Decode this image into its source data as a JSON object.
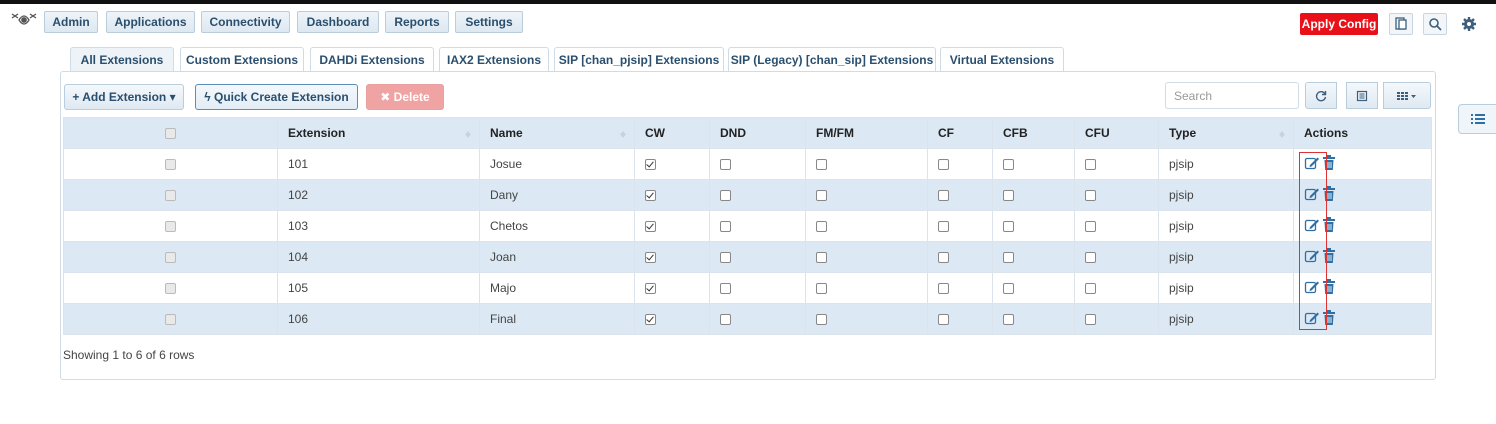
{
  "nav": {
    "items": [
      "Admin",
      "Applications",
      "Connectivity",
      "Dashboard",
      "Reports",
      "Settings"
    ],
    "apply_config": "Apply Config"
  },
  "tabs": [
    "All Extensions",
    "Custom Extensions",
    "DAHDi Extensions",
    "IAX2 Extensions",
    "SIP [chan_pjsip] Extensions",
    "SIP (Legacy) [chan_sip] Extensions",
    "Virtual Extensions"
  ],
  "toolbar": {
    "add_label": "+ Add Extension ▾",
    "quick_label": "ϟ Quick Create Extension",
    "delete_label": "✖ Delete",
    "search_placeholder": "Search"
  },
  "table": {
    "columns": [
      "",
      "Extension",
      "Name",
      "CW",
      "DND",
      "FM/FM",
      "CF",
      "CFB",
      "CFU",
      "Type",
      "Actions"
    ],
    "rows": [
      {
        "extension": "101",
        "name": "Josue",
        "cw": true,
        "type": "pjsip"
      },
      {
        "extension": "102",
        "name": "Dany",
        "cw": true,
        "type": "pjsip"
      },
      {
        "extension": "103",
        "name": "Chetos",
        "cw": true,
        "type": "pjsip"
      },
      {
        "extension": "104",
        "name": "Joan",
        "cw": true,
        "type": "pjsip"
      },
      {
        "extension": "105",
        "name": "Majo",
        "cw": true,
        "type": "pjsip"
      },
      {
        "extension": "106",
        "name": "Final",
        "cw": true,
        "type": "pjsip"
      }
    ]
  },
  "footer": {
    "rows_info": "Showing 1 to 6 of 6 rows"
  },
  "colors": {
    "accent": "#2a4f6e",
    "apply": "#e8111a",
    "row_stripe": "#dce9f4",
    "highlight": "#dd3333"
  }
}
